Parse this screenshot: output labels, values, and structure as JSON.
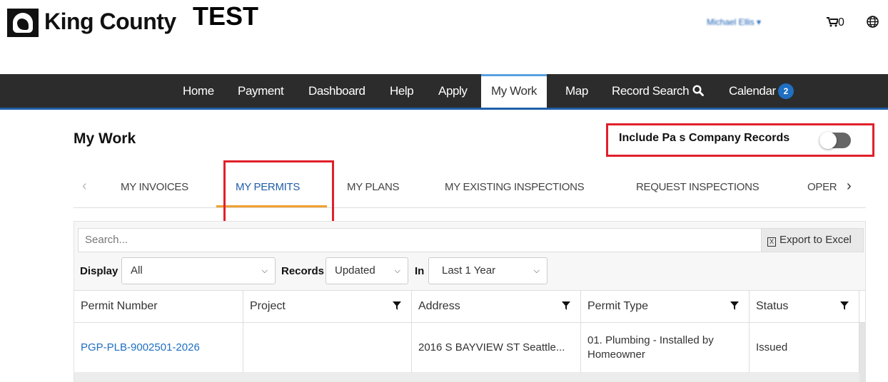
{
  "header": {
    "logo_text": "King County",
    "env_label": "TEST",
    "user_menu": "Michael Ellis ▾",
    "cart_count": "0",
    "globe_icon": "globe-icon",
    "cart_icon": "cart-icon"
  },
  "nav": {
    "items": [
      "Home",
      "Payment",
      "Dashboard",
      "Help",
      "Apply",
      "My Work",
      "Map",
      "Record Search",
      "Calendar"
    ],
    "active": "My Work",
    "calendar_badge": "2"
  },
  "page": {
    "title": "My Work",
    "toggle_label": "Include Pa      s Company Records",
    "toggle_on": false
  },
  "tabs": {
    "items": [
      "MY INVOICES",
      "MY PERMITS",
      "MY PLANS",
      "MY EXISTING INSPECTIONS",
      "REQUEST INSPECTIONS",
      "OPER"
    ],
    "active": "MY PERMITS",
    "prev": "‹",
    "next": "›"
  },
  "toolbar": {
    "search_placeholder": "Search...",
    "export_label": "Export to Excel",
    "display_label": "Display",
    "display_value": "All",
    "records_label": "Records",
    "records_value": "Updated",
    "in_label": "In",
    "in_value": "Last 1 Year"
  },
  "table": {
    "columns": [
      "Permit Number",
      "Project",
      "Address",
      "Permit Type",
      "Status"
    ],
    "rows": [
      {
        "permit_number": "PGP-PLB-9002501-2026",
        "project": "",
        "address": "2016 S BAYVIEW ST Seattle...",
        "permit_type": "01. Plumbing - Installed by Homeowner",
        "status": "Issued"
      }
    ]
  },
  "colors": {
    "nav_bg": "#2c2c2c",
    "accent_blue": "#1f6fc2",
    "tab_underline": "#f0a030",
    "highlight_red": "#e0202a"
  }
}
